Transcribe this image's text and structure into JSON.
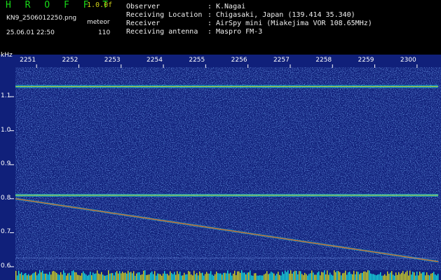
{
  "header": {
    "app_title": "H R O F F T",
    "version": "1.0.0f",
    "file_name": "KN9_2506012250.png",
    "mode_label": "meteor",
    "date_time": "25.06.01 22:50",
    "mode_value": "110"
  },
  "info": [
    {
      "label": "Observer",
      "value": "K.Nagai"
    },
    {
      "label": "Receiving Location",
      "value": "Chigasaki, Japan (139.414 35.340)"
    },
    {
      "label": "Receiver",
      "value": "AirSpy mini (Miakejima VOR 108.65MHz)"
    },
    {
      "label": "Receiving antenna",
      "value": "Maspro FM-3"
    }
  ],
  "colon": ":",
  "axes": {
    "y_unit": "kHz",
    "y_ticks": [
      "1.1",
      "1.0",
      "0.9",
      "0.8",
      "0.7",
      "0.6"
    ],
    "x_ticks": [
      "2251",
      "2252",
      "2253",
      "2254",
      "2255",
      "2256",
      "2257",
      "2258",
      "2259",
      "2300"
    ]
  },
  "chart_data": {
    "type": "heatmap",
    "x": [
      "2251",
      "2252",
      "2253",
      "2254",
      "2255",
      "2256",
      "2257",
      "2258",
      "2259",
      "2300"
    ],
    "y_ticks": [
      1.1,
      1.0,
      0.9,
      0.8,
      0.7,
      0.6
    ],
    "ylabel": "kHz",
    "ylim": [
      0.6,
      1.16
    ],
    "xlim_minutes": [
      22.5,
      32.5
    ],
    "features": [
      {
        "kind": "horizontal",
        "freq_khz": 1.13
      },
      {
        "kind": "horizontal",
        "freq_khz": 0.81
      },
      {
        "kind": "drift",
        "start": {
          "minute": 22.5,
          "freq_khz": 0.8
        },
        "end": {
          "minute": 32.5,
          "freq_khz": 0.615
        }
      }
    ],
    "colors": {
      "background": "#10207a",
      "noise": "#2850d0",
      "signal": "#18e0e0",
      "hot": "#d8d820",
      "meteor": "#e06020"
    }
  }
}
